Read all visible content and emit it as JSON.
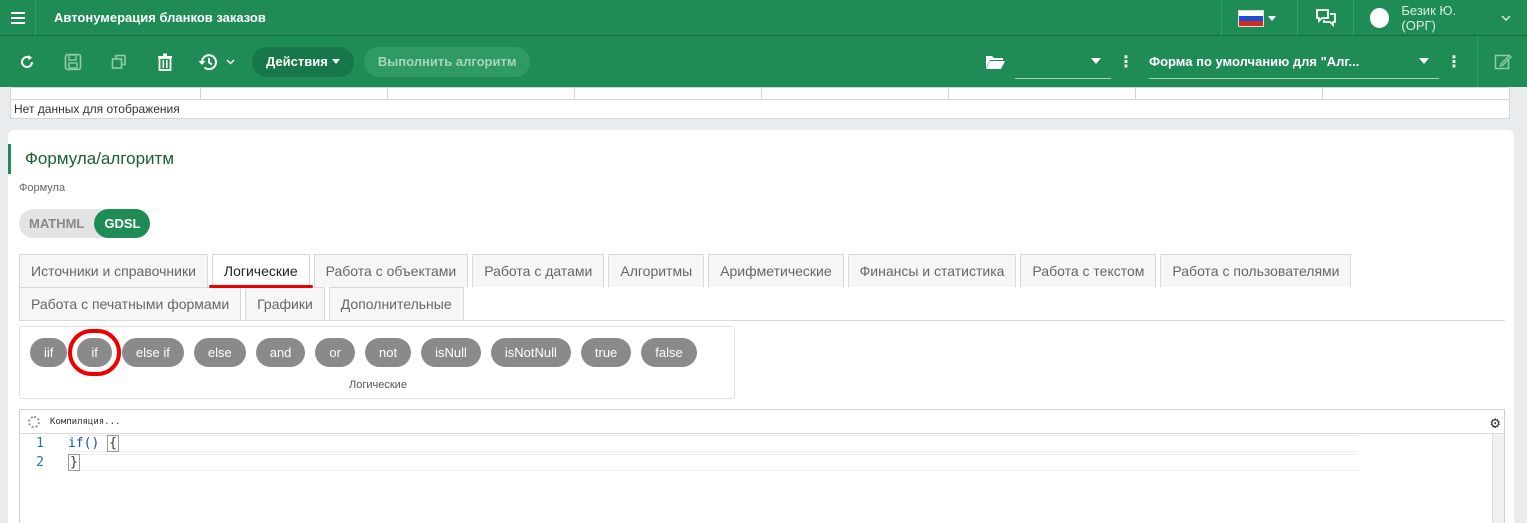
{
  "header": {
    "title": "Автонумерация бланков заказов",
    "user_name": "Безик Ю. (ОРГ)"
  },
  "toolbar": {
    "actions_label": "Действия",
    "run_algorithm_label": "Выполнить алгоритм",
    "form_select_value": "Форма по умолчанию для \"Алг..."
  },
  "grid": {
    "empty_text": "Нет данных для отображения"
  },
  "section": {
    "title": "Формула/алгоритм",
    "formula_label": "Формула",
    "toggle": {
      "mathml": "MATHML",
      "gdsl": "GDSL"
    }
  },
  "tabs": {
    "row1": [
      "Источники и справочники",
      "Логические",
      "Работа с объектами",
      "Работа с датами",
      "Алгоритмы",
      "Арифметические",
      "Финансы и статистика",
      "Работа с текстом",
      "Работа с пользователями"
    ],
    "row2": [
      "Работа с печатными формами",
      "Графики",
      "Дополнительные"
    ]
  },
  "functions": {
    "buttons": [
      "iif",
      "if",
      "else if",
      "else",
      "and",
      "or",
      "not",
      "isNull",
      "isNotNull",
      "true",
      "false"
    ],
    "group_label": "Логические"
  },
  "editor": {
    "status": "Компиляция...",
    "lines": [
      {
        "num": "1",
        "code": "if() ",
        "brace": "{"
      },
      {
        "num": "2",
        "code": "",
        "brace": "}"
      }
    ]
  },
  "colors": {
    "brand": "#1f8c55",
    "highlight": "#ff0000",
    "pill": "#8a8a8a"
  }
}
